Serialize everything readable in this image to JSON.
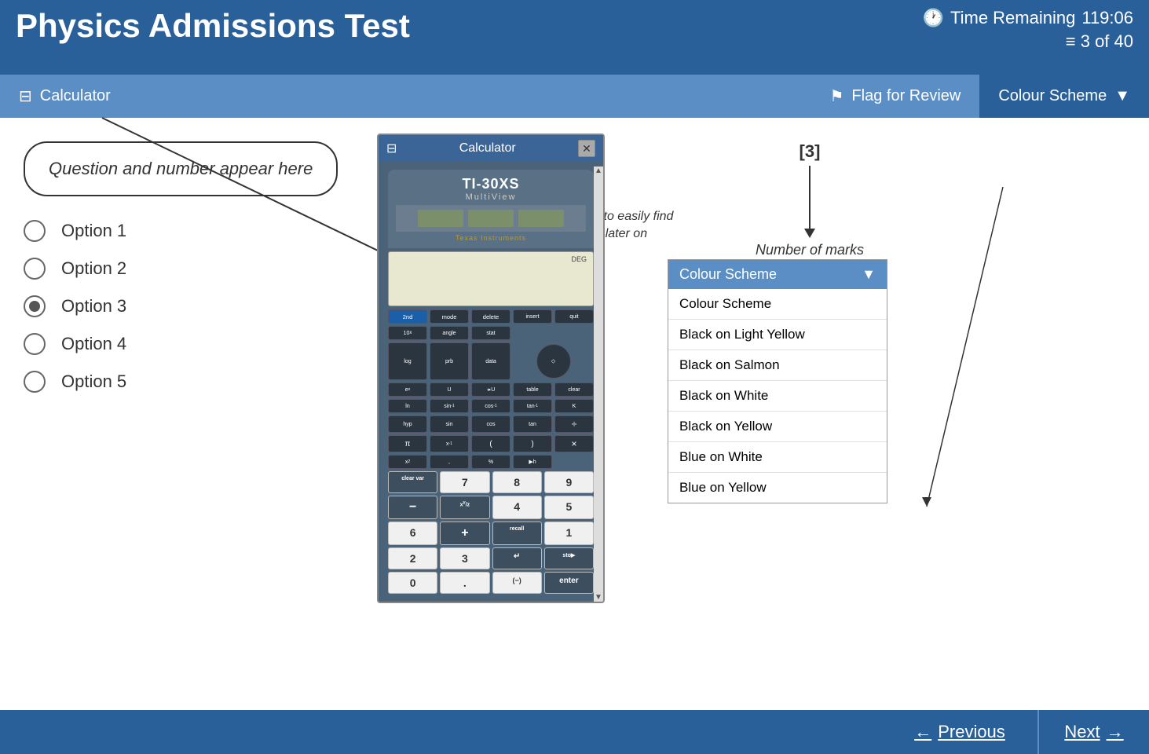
{
  "header": {
    "title": "Physics Admissions Test",
    "time_label": "Time Remaining",
    "time_value": "119:06",
    "question_count_label": "3 of 40"
  },
  "toolbar": {
    "calculator_label": "Calculator",
    "flag_label": "Flag for Review",
    "colour_scheme_label": "Colour Scheme"
  },
  "question": {
    "text": "Question and number appear here"
  },
  "options": [
    {
      "label": "Option 1",
      "selected": false
    },
    {
      "label": "Option 2",
      "selected": false
    },
    {
      "label": "Option 3",
      "selected": true
    },
    {
      "label": "Option 4",
      "selected": false
    },
    {
      "label": "Option 5",
      "selected": false
    }
  ],
  "annotations": {
    "flag_hint": "Flag questions to easily find\nand revisit later on",
    "marks_bracket": "[3]",
    "marks_label": "Number of marks"
  },
  "colour_scheme_dropdown": {
    "header": "Colour Scheme",
    "options": [
      "Colour Scheme",
      "Black on Light Yellow",
      "Black on Salmon",
      "Black on White",
      "Black on Yellow",
      "Blue on White",
      "Blue on Yellow"
    ]
  },
  "calculator": {
    "title": "Calculator",
    "model": "TI-30XS",
    "multiview": "MultiView",
    "brand": "Texas Instruments",
    "screen_deg": "DEG",
    "buttons_row1": [
      "2nd",
      "mode",
      "delete",
      "",
      ""
    ],
    "buttons_row2": [
      "10x",
      "angle",
      "stat",
      "",
      ""
    ],
    "buttons_row3": [
      "log",
      "prb",
      "data",
      "",
      ""
    ],
    "buttons_row4": [
      "ex",
      "",
      "",
      "table",
      "clear"
    ],
    "buttons_row5": [
      "ln",
      "sin-1",
      "cos-1",
      "tan-1",
      ""
    ],
    "buttons_row6": [
      "hyp",
      "sin",
      "cos",
      "tan",
      "÷"
    ],
    "numpad": [
      "7",
      "8",
      "9",
      "−",
      "4",
      "5",
      "6",
      "+",
      "1",
      "2",
      "3",
      "↵",
      "0",
      ".",
      "(−)",
      "enter"
    ]
  },
  "footer": {
    "previous_label": "Previous",
    "next_label": "Next",
    "prev_arrow": "←",
    "next_arrow": "→"
  },
  "icons": {
    "clock": "🕐",
    "calculator": "⊟",
    "flag": "⚑",
    "chevron_down": "▼",
    "close": "✕",
    "left_arrow": "←",
    "right_arrow": "→",
    "question_count_icon": "≡"
  }
}
